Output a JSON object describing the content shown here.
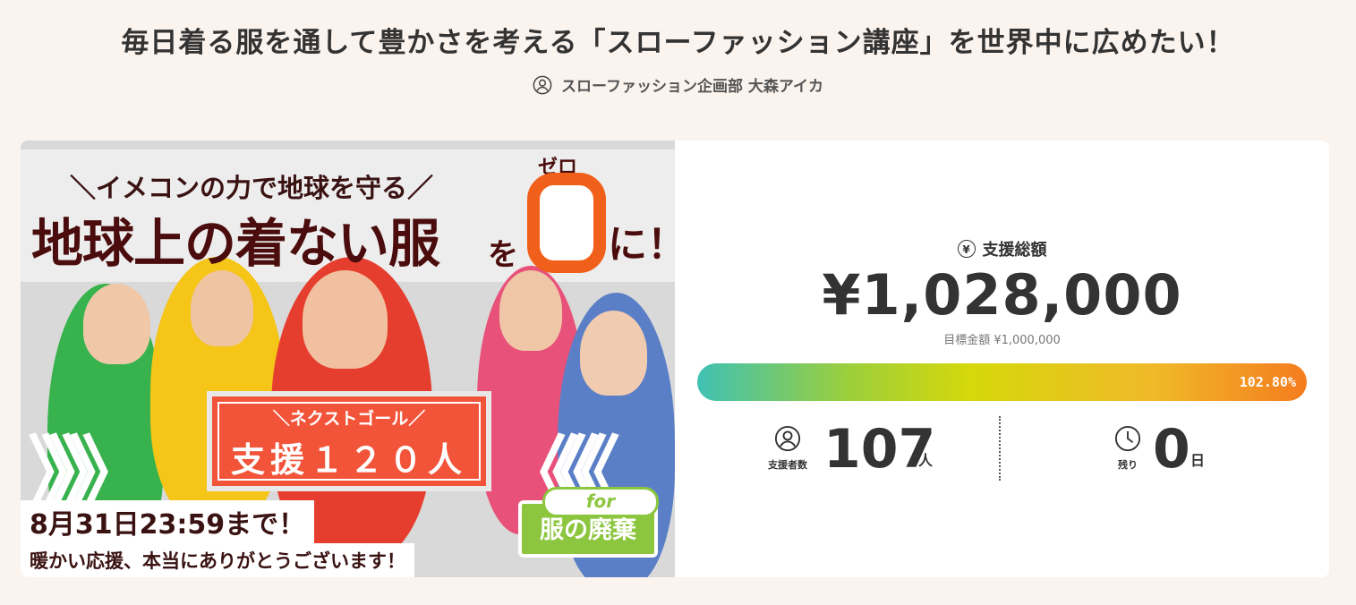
{
  "header": {
    "title": "毎日着る服を通して豊かさを考える「スローファッション講座」を世界中に広めたい！",
    "owner_name": "スローファッション企画部 大森アイカ"
  },
  "hero": {
    "tagline": "＼イメコンの力で地球を守る／",
    "headline": "地球上の着ない服",
    "particle_wo": "を",
    "zero_ruby": "ゼロ",
    "particle_ni": "に！",
    "goal_label": "＼ネクストゴール／",
    "goal_value": "支援１２０人",
    "arrows_left": "》》》",
    "arrows_right": "《《《",
    "for_label": "for",
    "for_text": "服の廃棄",
    "deadline": "8月31日23:59まで！",
    "thanks": "暖かい応援、本当にありがとうございます！"
  },
  "stats": {
    "total_label": "支援総額",
    "total_amount": "¥1,028,000",
    "goal_amount": "目標金額 ¥1,000,000",
    "progress_percent": 102.8,
    "progress_label": "102.80%",
    "supporters_caption": "支援者数",
    "supporters_count": "107",
    "supporters_unit": "人",
    "remaining_caption": "残り",
    "remaining_count": "0",
    "remaining_unit": "日"
  },
  "colors": {
    "background": "#fbf3ee",
    "accent_orange": "#f0601a",
    "accent_green": "#8cc63f",
    "goal_red": "#f2543a"
  },
  "icons": {
    "owner": "user-circle-icon",
    "total": "yen-circle-icon",
    "supporters": "user-circle-icon",
    "remaining": "clock-icon"
  }
}
